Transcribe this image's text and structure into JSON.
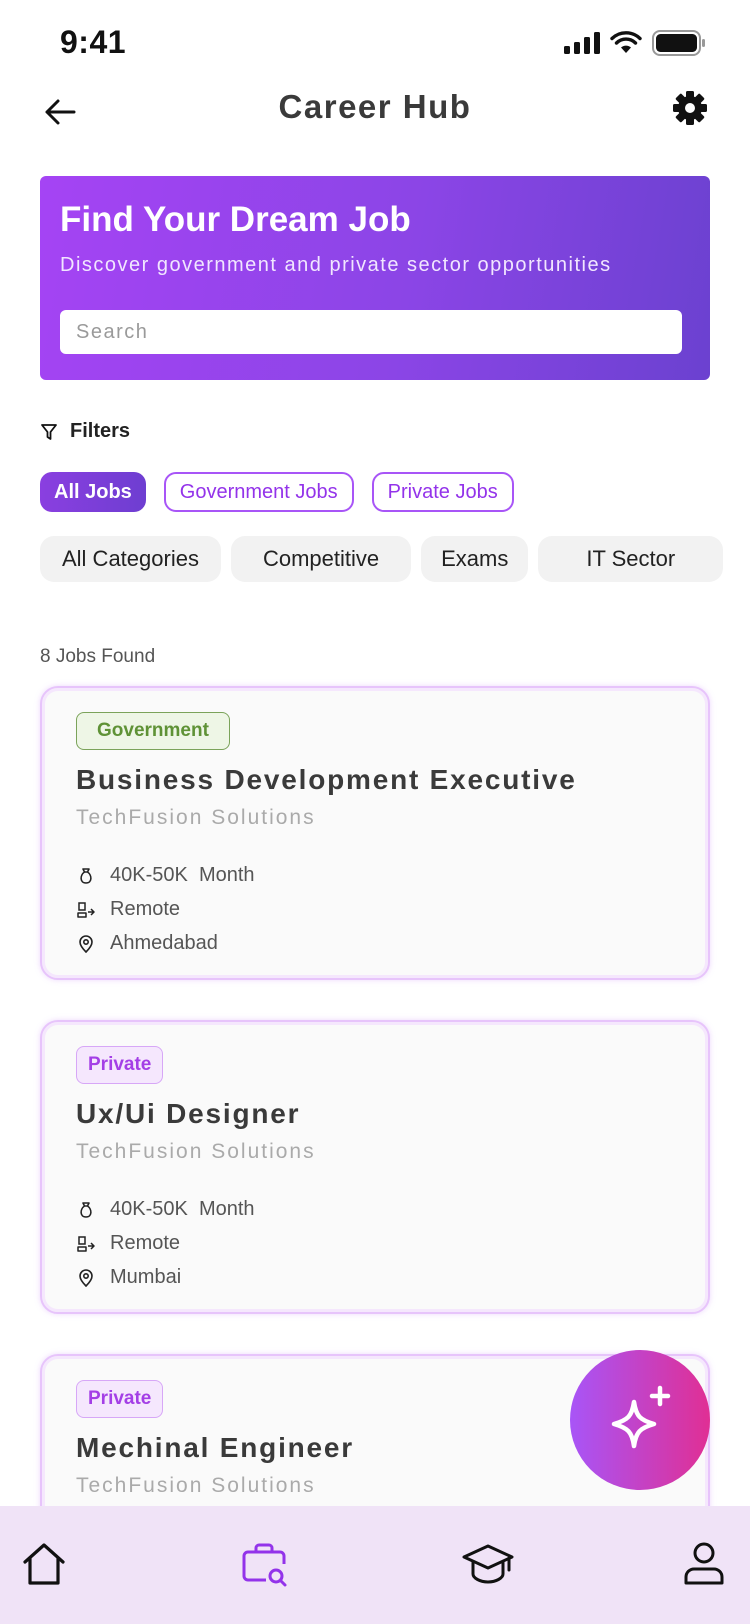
{
  "status_bar": {
    "time": "9:41"
  },
  "header": {
    "title": "Career Hub"
  },
  "hero": {
    "title": "Find Your Dream Job",
    "subtitle": "Discover government and private sector opportunities",
    "search_placeholder": "Search"
  },
  "filters": {
    "label": "Filters",
    "type_chips": [
      {
        "label": "All Jobs",
        "active": true
      },
      {
        "label": "Government Jobs",
        "active": false
      },
      {
        "label": "Private Jobs",
        "active": false
      }
    ],
    "categories": [
      "All Categories",
      "Competitive",
      "Exams",
      "IT Sector"
    ]
  },
  "results": {
    "count_text": "8 Jobs Found"
  },
  "jobs": [
    {
      "badge": "Government",
      "title": "Business Development Executive",
      "company": "TechFusion Solutions",
      "salary": "40K-50K  Month",
      "mode": "Remote",
      "location": "Ahmedabad"
    },
    {
      "badge": "Private",
      "title": "Ux/Ui Designer",
      "company": "TechFusion Solutions",
      "salary": "40K-50K  Month",
      "mode": "Remote",
      "location": "Mumbai"
    },
    {
      "badge": "Private",
      "title": "Mechinal Engineer",
      "company": "TechFusion Solutions"
    }
  ],
  "colors": {
    "accent": "#9333ea",
    "gov_green": "#5f9236",
    "nav_bg": "#f0e3f7",
    "fab_start": "#a855f7",
    "fab_end": "#e02f94"
  },
  "bottom_nav": [
    "home-icon",
    "job-search-icon",
    "graduation-cap-icon",
    "profile-icon"
  ]
}
